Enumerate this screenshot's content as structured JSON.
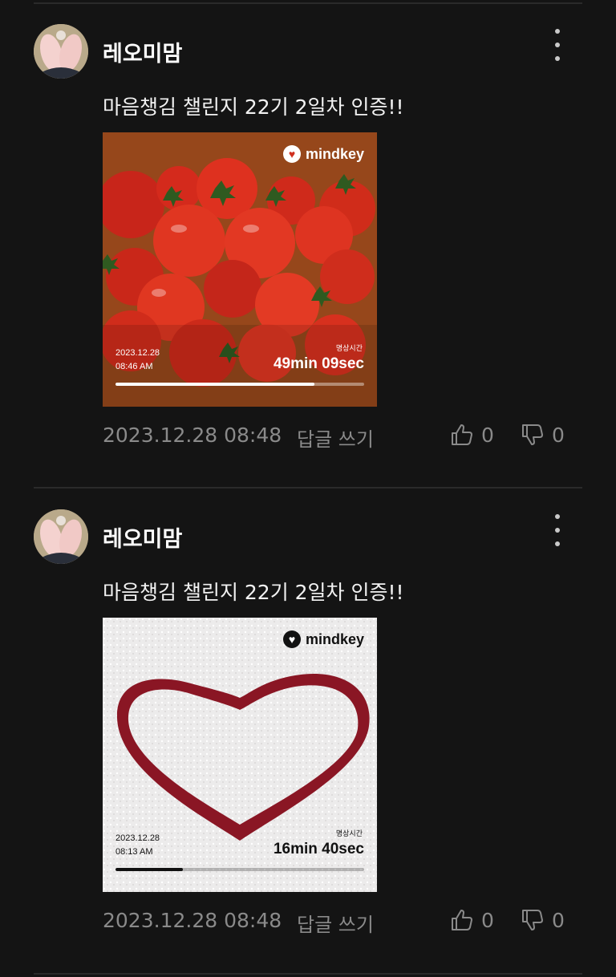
{
  "posts": [
    {
      "author": "레오미맘",
      "content": "마음챙김 챌린지 22기 2일차 인증!!",
      "image": {
        "subject": "tomatoes",
        "brand": "mindkey",
        "date": "2023.12.28",
        "time": "08:46 AM",
        "label_kr": "명상시간",
        "duration": "49min 09sec",
        "progress": 0.8,
        "text_color": "#ffffff"
      },
      "timestamp": "2023.12.28 08:48",
      "reply_label": "답글 쓰기",
      "likes": "0",
      "dislikes": "0"
    },
    {
      "author": "레오미맘",
      "content": "마음챙김 챌린지 22기 2일차 인증!!",
      "image": {
        "subject": "snow heart",
        "brand": "mindkey",
        "date": "2023.12.28",
        "time": "08:13 AM",
        "label_kr": "명상시간",
        "duration": "16min 40sec",
        "progress": 0.27,
        "text_color": "#111111"
      },
      "timestamp": "2023.12.28 08:48",
      "reply_label": "답글 쓰기",
      "likes": "0",
      "dislikes": "0"
    }
  ],
  "icons": {
    "more": "more-vertical-icon",
    "like": "thumbs-up-icon",
    "dislike": "thumbs-down-icon",
    "brand": "mindkey-logo-icon"
  },
  "colors": {
    "background": "#141414",
    "divider": "#2a2a2a",
    "muted_text": "#8a8a8a"
  }
}
